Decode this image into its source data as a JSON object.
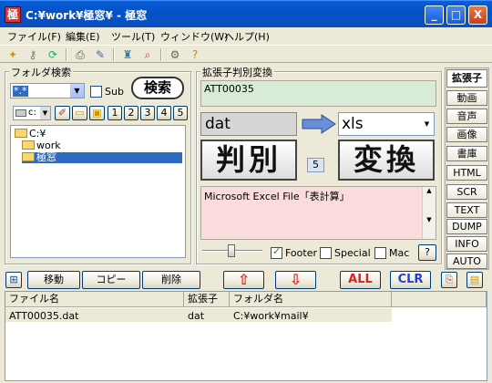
{
  "window": {
    "title": "C:¥work¥極窓¥ - 極窓",
    "icon_text": "極",
    "min": "_",
    "max": "□",
    "close": "X"
  },
  "menu": [
    "ファイル(F)",
    "編集(E)",
    "ツール(T)",
    "ウィンドウ(W)",
    "ヘルプ(H)"
  ],
  "toolbar_icons": [
    "new-icon",
    "key-icon",
    "refresh-icon",
    "print-icon",
    "edit-icon",
    "trash-icon",
    "search-icon",
    "settings-icon",
    "help-icon"
  ],
  "folder_search": {
    "group_label": "フォルダ検索",
    "pattern_value": "*.*",
    "sub_label": "Sub",
    "search_button": "検索",
    "drive_value": "c:",
    "num_buttons": [
      "1",
      "2",
      "3",
      "4",
      "5"
    ],
    "tree": [
      {
        "label": "C:¥"
      },
      {
        "label": "work"
      },
      {
        "label": "極窓"
      }
    ]
  },
  "ext_panel": {
    "group_label": "拡張子判別変換",
    "filename": "ATT00035",
    "from_ext": "dat",
    "to_ext": "xls",
    "judge_button": "判別",
    "count": "5",
    "convert_button": "変換",
    "description": "Microsoft Excel File「表計算」",
    "footer_label": "Footer",
    "special_label": "Special",
    "mac_label": "Mac",
    "help_button": "?"
  },
  "side_tabs": [
    "拡張子",
    "動画",
    "音声",
    "画像",
    "書庫",
    "HTML",
    "SCR",
    "TEXT",
    "DUMP",
    "INFO",
    "AUTO"
  ],
  "action_bar": {
    "move": "移動",
    "copy": "コピー",
    "delete": "削除",
    "up": "⇧",
    "down": "⇩",
    "all": "ALL",
    "clr": "CLR"
  },
  "file_list": {
    "columns": [
      "ファイル名",
      "拡張子",
      "フォルダ名"
    ],
    "rows": [
      {
        "name": "ATT00035.dat",
        "ext": "dat",
        "folder": "C:¥work¥mail¥"
      }
    ]
  },
  "colors": {
    "accent": "#0a5fd8",
    "selection": "#316ac5",
    "filename_bg": "#d7ebd6",
    "description_bg": "#fadcdc",
    "red": "#e02020",
    "blue": "#1f3fd6"
  }
}
